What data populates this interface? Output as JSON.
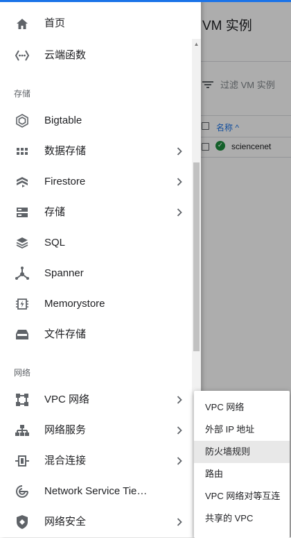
{
  "background": {
    "page_title": "VM 实例",
    "filter_placeholder": "过滤 VM 实例",
    "column_name": "名称 ^",
    "instance_name": "sciencenet"
  },
  "sidebar": {
    "top_items": [
      {
        "label": "首页",
        "icon": "home-icon"
      },
      {
        "label": "云端函数",
        "icon": "cloud-functions-icon"
      }
    ],
    "section_storage": "存储",
    "storage_items": [
      {
        "label": "Bigtable",
        "icon": "bigtable-icon",
        "chevron": false
      },
      {
        "label": "数据存储",
        "icon": "datastore-icon",
        "chevron": true
      },
      {
        "label": "Firestore",
        "icon": "firestore-icon",
        "chevron": true
      },
      {
        "label": "存储",
        "icon": "storage-icon",
        "chevron": true
      },
      {
        "label": "SQL",
        "icon": "sql-icon",
        "chevron": false
      },
      {
        "label": "Spanner",
        "icon": "spanner-icon",
        "chevron": false
      },
      {
        "label": "Memorystore",
        "icon": "memorystore-icon",
        "chevron": false
      },
      {
        "label": "文件存储",
        "icon": "filestore-icon",
        "chevron": false
      }
    ],
    "section_network": "网络",
    "network_items": [
      {
        "label": "VPC 网络",
        "icon": "vpc-network-icon",
        "chevron": true
      },
      {
        "label": "网络服务",
        "icon": "network-services-icon",
        "chevron": true
      },
      {
        "label": "混合连接",
        "icon": "hybrid-connectivity-icon",
        "chevron": true
      },
      {
        "label": "Network Service Tie…",
        "icon": "network-service-tiers-icon",
        "chevron": false
      },
      {
        "label": "网络安全",
        "icon": "network-security-icon",
        "chevron": true
      }
    ]
  },
  "submenu": {
    "items": [
      {
        "label": "VPC 网络",
        "active": false
      },
      {
        "label": "外部 IP 地址",
        "active": false
      },
      {
        "label": "防火墙规则",
        "active": true
      },
      {
        "label": "路由",
        "active": false
      },
      {
        "label": "VPC 网络对等互连",
        "active": false
      },
      {
        "label": "共享的 VPC",
        "active": false
      }
    ]
  },
  "colors": {
    "accent": "#1a73e8",
    "status_ok": "#1e8e3e",
    "icon_gray": "#5f6368",
    "submenu_active_bg": "#e8e8e8"
  }
}
